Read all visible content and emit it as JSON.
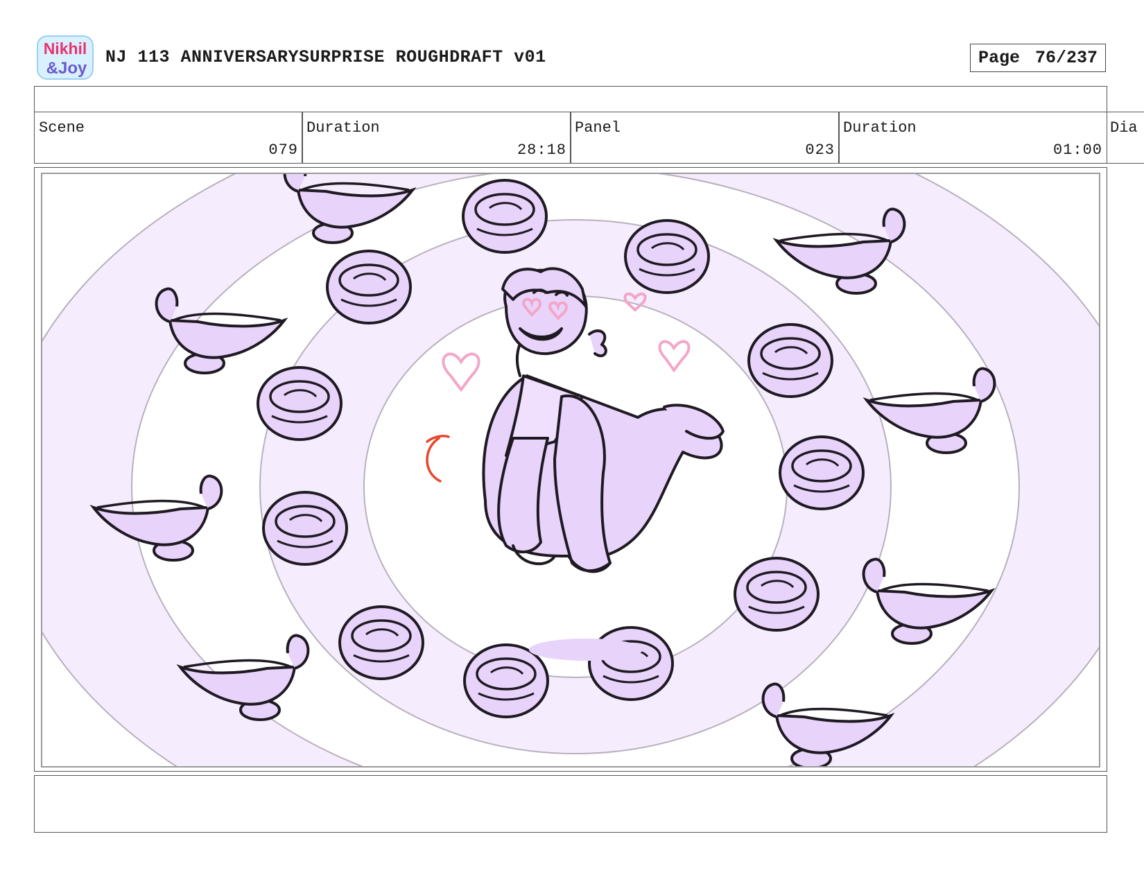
{
  "header": {
    "logo": {
      "line1": "Nikhil",
      "line2": "&Joy",
      "icon": "nikhil-and-joy-logo"
    },
    "title": "NJ 113 ANNIVERSARYSURPRISE ROUGHDRAFT v01",
    "page_label": "Page",
    "page_value": "76/237"
  },
  "info": {
    "scene_label": "Scene",
    "scene_value": "079",
    "scene_duration_label": "Duration",
    "scene_duration_value": "28:18",
    "panel_label": "Panel",
    "panel_value": "023",
    "panel_duration_label": "Duration",
    "panel_duration_value": "01:00",
    "dialogue_label": "Dia"
  },
  "panel": {
    "drawing": "storyboard-sketch",
    "colors": {
      "fill": "#e8d3fb",
      "ring": "#f5ecfd",
      "line": "#1f1a22",
      "blush": "#f3a6c8",
      "accent": "#e8452a"
    }
  },
  "notes": {}
}
